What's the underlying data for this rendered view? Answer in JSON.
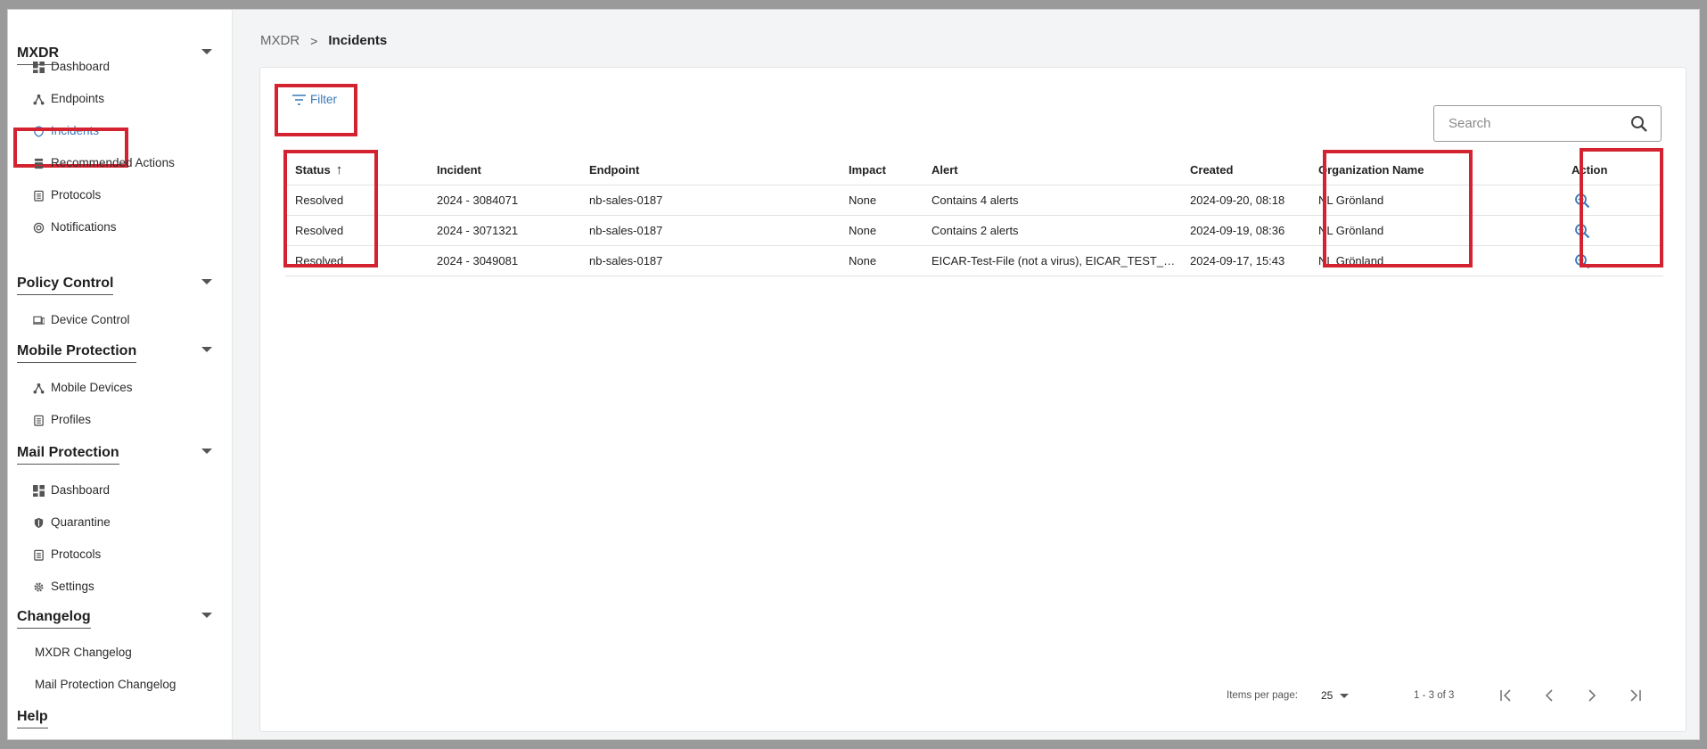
{
  "sidebar": {
    "sections": [
      {
        "title": "MXDR",
        "items": [
          {
            "label": "Dashboard",
            "icon": "dashboard-icon"
          },
          {
            "label": "Endpoints",
            "icon": "endpoints-icon"
          },
          {
            "label": "Incidents",
            "icon": "shield-icon",
            "active": true
          },
          {
            "label": "Recommended Actions",
            "icon": "recommended-actions-icon"
          },
          {
            "label": "Protocols",
            "icon": "clipboard-icon"
          },
          {
            "label": "Notifications",
            "icon": "notifications-icon"
          }
        ]
      },
      {
        "title": "Policy Control",
        "items": [
          {
            "label": "Device Control",
            "icon": "device-icon"
          }
        ]
      },
      {
        "title": "Mobile Protection",
        "items": [
          {
            "label": "Mobile Devices",
            "icon": "mobile-devices-icon"
          },
          {
            "label": "Profiles",
            "icon": "clipboard-icon"
          }
        ]
      },
      {
        "title": "Mail Protection",
        "items": [
          {
            "label": "Dashboard",
            "icon": "dashboard-icon"
          },
          {
            "label": "Quarantine",
            "icon": "quarantine-shield-icon"
          },
          {
            "label": "Protocols",
            "icon": "clipboard-icon"
          },
          {
            "label": "Settings",
            "icon": "gear-icon"
          }
        ]
      },
      {
        "title": "Changelog",
        "items": [
          {
            "label": "MXDR Changelog"
          },
          {
            "label": "Mail Protection Changelog"
          }
        ]
      },
      {
        "title": "Help",
        "items": []
      }
    ]
  },
  "breadcrumb": {
    "root": "MXDR",
    "separator": ">",
    "current": "Incidents"
  },
  "toolbar": {
    "filter_label": "Filter",
    "search_placeholder": "Search"
  },
  "table": {
    "headers": {
      "status": "Status",
      "incident": "Incident",
      "endpoint": "Endpoint",
      "impact": "Impact",
      "alert": "Alert",
      "created": "Created",
      "organization": "Organization Name",
      "action": "Action"
    },
    "sort": {
      "column": "status",
      "direction": "ascending"
    },
    "rows": [
      {
        "status": "Resolved",
        "incident": "2024 - 3084071",
        "endpoint": "nb-sales-0187",
        "impact": "None",
        "alert": "Contains 4 alerts",
        "created": "2024-09-20, 08:18",
        "organization": "NL Grönland"
      },
      {
        "status": "Resolved",
        "incident": "2024 - 3071321",
        "endpoint": "nb-sales-0187",
        "impact": "None",
        "alert": "Contains 2 alerts",
        "created": "2024-09-19, 08:36",
        "organization": "NL Grönland"
      },
      {
        "status": "Resolved",
        "incident": "2024 - 3049081",
        "endpoint": "nb-sales-0187",
        "impact": "None",
        "alert": "EICAR-Test-File (not a virus), EICAR_TEST_FI…",
        "created": "2024-09-17, 15:43",
        "organization": "NL Grönland"
      }
    ]
  },
  "paginator": {
    "items_per_page_label": "Items per page:",
    "page_size": "25",
    "range": "1 - 3 of 3"
  },
  "colors": {
    "accent": "#3a78b8",
    "highlight": "#d42330"
  }
}
